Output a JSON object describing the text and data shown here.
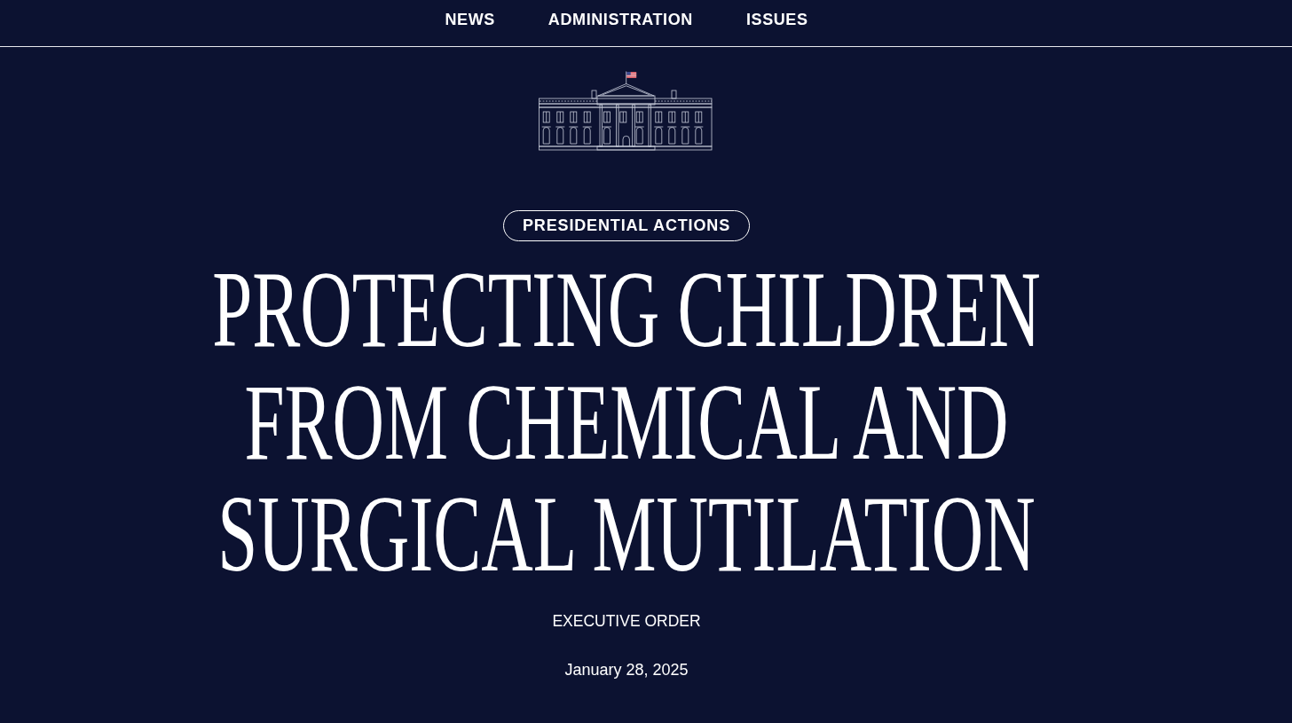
{
  "nav": {
    "items": [
      {
        "label": "NEWS"
      },
      {
        "label": "ADMINISTRATION"
      },
      {
        "label": "ISSUES"
      }
    ]
  },
  "article": {
    "category": "PRESIDENTIAL ACTIONS",
    "title": "PROTECTING CHILDREN FROM CHEMICAL AND SURGICAL MUTILATION",
    "doc_type": "EXECUTIVE ORDER",
    "date": "January 28, 2025"
  }
}
